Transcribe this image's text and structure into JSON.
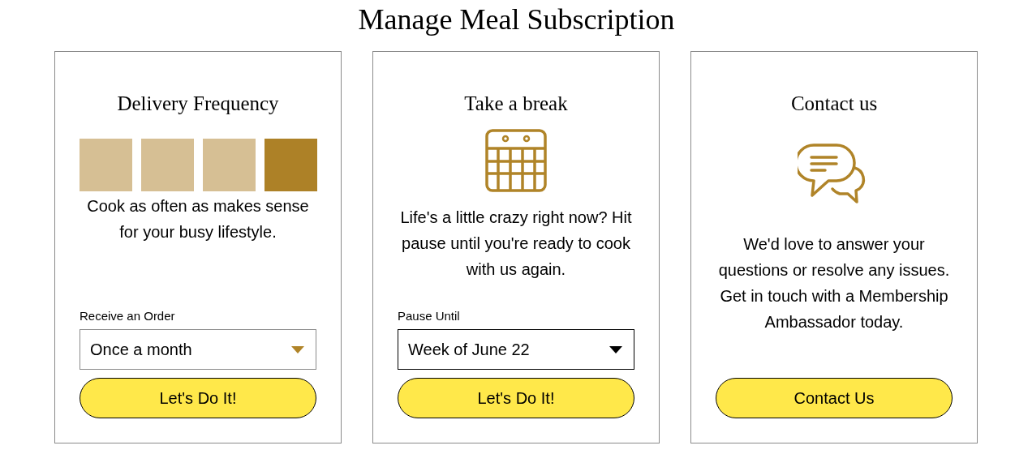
{
  "page_title": "Manage Meal Subscription",
  "cards": [
    {
      "kind": "frequency",
      "title": "Delivery Frequency",
      "frequency_options": [
        {
          "selected": false
        },
        {
          "selected": false
        },
        {
          "selected": false
        },
        {
          "selected": true
        }
      ],
      "text": "Cook as often as makes sense for your busy lifestyle.",
      "select": {
        "label": "Receive an Order",
        "value": "Once a month",
        "focused": false
      },
      "button": "Let's Do It!"
    },
    {
      "kind": "calendar",
      "title": "Take a break",
      "text": "Life's a little crazy right now? Hit pause until you're ready to cook with us again.",
      "select": {
        "label": "Pause Until",
        "value": "Week of June 22",
        "focused": true
      },
      "button": "Let's Do It!"
    },
    {
      "kind": "contact",
      "title": "Contact us",
      "text": "We'd love to answer your questions or resolve any issues. Get in touch with a Membership Ambassador today.",
      "button": "Contact Us"
    }
  ]
}
